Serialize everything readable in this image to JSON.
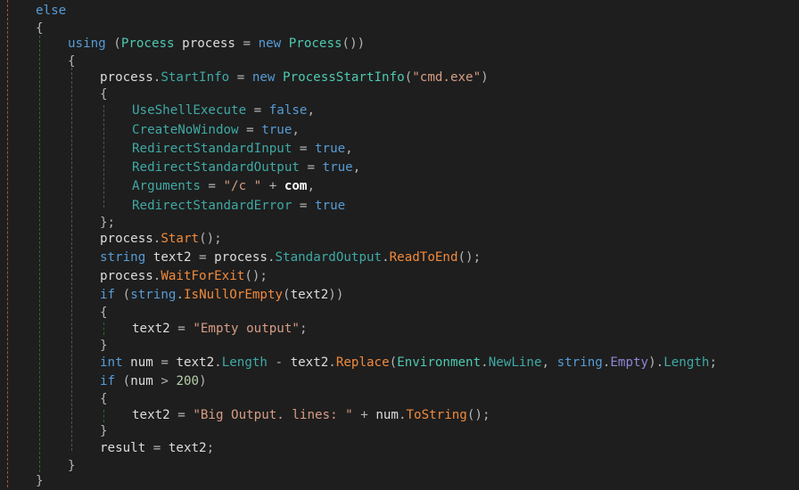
{
  "editor": {
    "language": "C#",
    "theme": "dark",
    "lines": [
      {
        "indent": 0,
        "tokens": [
          [
            "kw",
            "else"
          ]
        ]
      },
      {
        "indent": 0,
        "tokens": [
          [
            "pu",
            "{"
          ]
        ]
      },
      {
        "indent": 1,
        "tokens": [
          [
            "kw",
            "using"
          ],
          [
            "pu",
            " ("
          ],
          [
            "ty",
            "Process"
          ],
          [
            "va",
            " process "
          ],
          [
            "pu",
            "= "
          ],
          [
            "kw",
            "new"
          ],
          [
            "pu",
            " "
          ],
          [
            "ty",
            "Process"
          ],
          [
            "pu",
            "())"
          ]
        ]
      },
      {
        "indent": 1,
        "tokens": [
          [
            "pu",
            "{"
          ]
        ]
      },
      {
        "indent": 2,
        "tokens": [
          [
            "va",
            "process"
          ],
          [
            "pu",
            "."
          ],
          [
            "pr",
            "StartInfo"
          ],
          [
            "pu",
            " = "
          ],
          [
            "kw",
            "new"
          ],
          [
            "pu",
            " "
          ],
          [
            "ty",
            "ProcessStartInfo"
          ],
          [
            "pu",
            "("
          ],
          [
            "st",
            "\"cmd.exe\""
          ],
          [
            "pu",
            ")"
          ]
        ]
      },
      {
        "indent": 2,
        "tokens": [
          [
            "pu",
            "{"
          ]
        ]
      },
      {
        "indent": 3,
        "tokens": [
          [
            "pr",
            "UseShellExecute"
          ],
          [
            "pu",
            " = "
          ],
          [
            "kw",
            "false"
          ],
          [
            "pu",
            ","
          ]
        ]
      },
      {
        "indent": 3,
        "tokens": [
          [
            "pr",
            "CreateNoWindow"
          ],
          [
            "pu",
            " = "
          ],
          [
            "kw",
            "true"
          ],
          [
            "pu",
            ","
          ]
        ]
      },
      {
        "indent": 3,
        "tokens": [
          [
            "pr",
            "RedirectStandardInput"
          ],
          [
            "pu",
            " = "
          ],
          [
            "kw",
            "true"
          ],
          [
            "pu",
            ","
          ]
        ]
      },
      {
        "indent": 3,
        "tokens": [
          [
            "pr",
            "RedirectStandardOutput"
          ],
          [
            "pu",
            " = "
          ],
          [
            "kw",
            "true"
          ],
          [
            "pu",
            ","
          ]
        ]
      },
      {
        "indent": 3,
        "tokens": [
          [
            "pr",
            "Arguments"
          ],
          [
            "pu",
            " = "
          ],
          [
            "st",
            "\"/c \""
          ],
          [
            "pu",
            " + "
          ],
          [
            "lo",
            "com"
          ],
          [
            "pu",
            ","
          ]
        ]
      },
      {
        "indent": 3,
        "tokens": [
          [
            "pr",
            "RedirectStandardError"
          ],
          [
            "pu",
            " = "
          ],
          [
            "kw",
            "true"
          ]
        ]
      },
      {
        "indent": 2,
        "tokens": [
          [
            "pu",
            "};"
          ]
        ]
      },
      {
        "indent": 2,
        "tokens": [
          [
            "va",
            "process"
          ],
          [
            "pu",
            "."
          ],
          [
            "me",
            "Start"
          ],
          [
            "pu",
            "();"
          ]
        ]
      },
      {
        "indent": 2,
        "tokens": [
          [
            "kw",
            "string"
          ],
          [
            "va",
            " text2 "
          ],
          [
            "pu",
            "= "
          ],
          [
            "va",
            "process"
          ],
          [
            "pu",
            "."
          ],
          [
            "pr",
            "StandardOutput"
          ],
          [
            "pu",
            "."
          ],
          [
            "me",
            "ReadToEnd"
          ],
          [
            "pu",
            "();"
          ]
        ]
      },
      {
        "indent": 2,
        "tokens": [
          [
            "va",
            "process"
          ],
          [
            "pu",
            "."
          ],
          [
            "me",
            "WaitForExit"
          ],
          [
            "pu",
            "();"
          ]
        ]
      },
      {
        "indent": 2,
        "tokens": [
          [
            "kw",
            "if"
          ],
          [
            "pu",
            " ("
          ],
          [
            "kw",
            "string"
          ],
          [
            "pu",
            "."
          ],
          [
            "me",
            "IsNullOrEmpty"
          ],
          [
            "pu",
            "("
          ],
          [
            "va",
            "text2"
          ],
          [
            "pu",
            "))"
          ]
        ]
      },
      {
        "indent": 2,
        "tokens": [
          [
            "pu",
            "{"
          ]
        ]
      },
      {
        "indent": 3,
        "tokens": [
          [
            "va",
            "text2"
          ],
          [
            "pu",
            " = "
          ],
          [
            "st",
            "\"Empty output\""
          ],
          [
            "pu",
            ";"
          ]
        ]
      },
      {
        "indent": 2,
        "tokens": [
          [
            "pu",
            "}"
          ]
        ]
      },
      {
        "indent": 2,
        "tokens": [
          [
            "kw",
            "int"
          ],
          [
            "va",
            " num "
          ],
          [
            "pu",
            "= "
          ],
          [
            "va",
            "text2"
          ],
          [
            "pu",
            "."
          ],
          [
            "pr",
            "Length"
          ],
          [
            "pu",
            " - "
          ],
          [
            "va",
            "text2"
          ],
          [
            "pu",
            "."
          ],
          [
            "me",
            "Replace"
          ],
          [
            "pu",
            "("
          ],
          [
            "ty",
            "Environment"
          ],
          [
            "pu",
            "."
          ],
          [
            "pr",
            "NewLine"
          ],
          [
            "pu",
            ", "
          ],
          [
            "kw",
            "string"
          ],
          [
            "pu",
            "."
          ],
          [
            "pe",
            "Empty"
          ],
          [
            "pu",
            ")."
          ],
          [
            "pr",
            "Length"
          ],
          [
            "pu",
            ";"
          ]
        ]
      },
      {
        "indent": 2,
        "tokens": [
          [
            "kw",
            "if"
          ],
          [
            "pu",
            " ("
          ],
          [
            "va",
            "num"
          ],
          [
            "pu",
            " > "
          ],
          [
            "nu",
            "200"
          ],
          [
            "pu",
            ")"
          ]
        ]
      },
      {
        "indent": 2,
        "tokens": [
          [
            "pu",
            "{"
          ]
        ]
      },
      {
        "indent": 3,
        "tokens": [
          [
            "va",
            "text2"
          ],
          [
            "pu",
            " = "
          ],
          [
            "st",
            "\"Big Output. lines: \""
          ],
          [
            "pu",
            " + "
          ],
          [
            "va",
            "num"
          ],
          [
            "pu",
            "."
          ],
          [
            "me",
            "ToString"
          ],
          [
            "pu",
            "();"
          ]
        ]
      },
      {
        "indent": 2,
        "tokens": [
          [
            "pu",
            "}"
          ]
        ]
      },
      {
        "indent": 2,
        "tokens": [
          [
            "va",
            "result"
          ],
          [
            "pu",
            " = "
          ],
          [
            "va",
            "text2"
          ],
          [
            "pu",
            ";"
          ]
        ]
      },
      {
        "indent": 1,
        "tokens": [
          [
            "pu",
            "}"
          ]
        ]
      },
      {
        "indent": 0,
        "tokens": [
          [
            "pu",
            "}"
          ]
        ]
      }
    ]
  }
}
